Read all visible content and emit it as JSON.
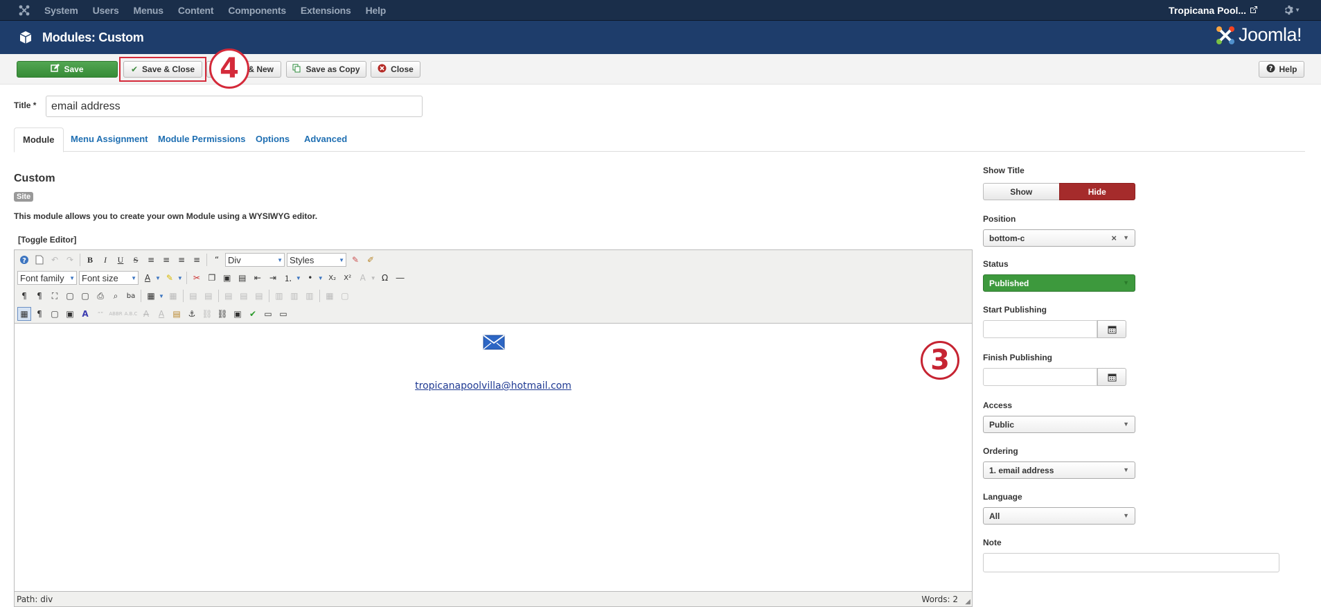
{
  "topnav": {
    "menu": [
      "System",
      "Users",
      "Menus",
      "Content",
      "Components",
      "Extensions",
      "Help"
    ],
    "site_name": "Tropicana Pool..."
  },
  "header": {
    "title": "Modules: Custom",
    "brand": "Joomla!"
  },
  "toolbar": {
    "save": "Save",
    "save_close": "Save & Close",
    "save_new": "& New",
    "save_copy": "Save as Copy",
    "close": "Close",
    "help": "Help"
  },
  "annotations": {
    "step4": "4",
    "step3": "3"
  },
  "form": {
    "title_label": "Title *",
    "title_value": "email address"
  },
  "tabs": [
    "Module",
    "Menu Assignment",
    "Module Permissions",
    "Options",
    "Advanced"
  ],
  "module": {
    "name": "Custom",
    "badge": "Site",
    "description": "This module allows you to create your own Module using a WYSIWYG editor.",
    "toggle_editor": "[Toggle Editor]"
  },
  "editor": {
    "format_select": "Div",
    "styles_select": "Styles",
    "font_family": "Font family",
    "font_size": "Font size",
    "email": "tropicanapoolvilla@hotmail.com",
    "path": "Path: div",
    "words": "Words: 2"
  },
  "right": {
    "show_title_label": "Show Title",
    "show": "Show",
    "hide": "Hide",
    "position_label": "Position",
    "position_value": "bottom-c",
    "status_label": "Status",
    "status_value": "Published",
    "start_label": "Start Publishing",
    "finish_label": "Finish Publishing",
    "access_label": "Access",
    "access_value": "Public",
    "ordering_label": "Ordering",
    "ordering_value": "1. email address",
    "language_label": "Language",
    "language_value": "All",
    "note_label": "Note"
  }
}
